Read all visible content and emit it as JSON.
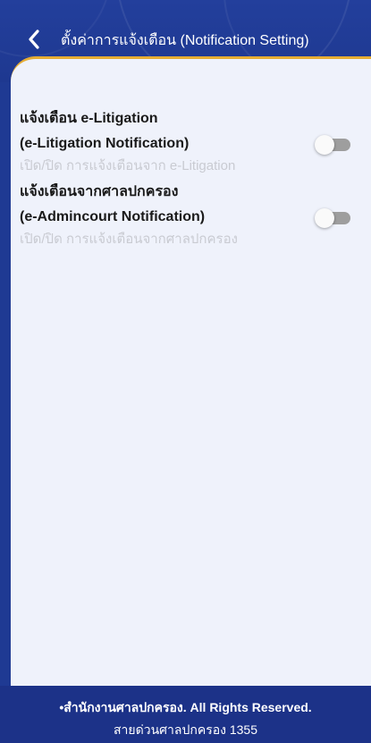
{
  "header": {
    "title": "ตั้งค่าการแจ้งเตือน (Notification Setting)",
    "back_icon": "chevron-left-icon"
  },
  "settings": [
    {
      "title_line1": "แจ้งเตือน e-Litigation",
      "title_line2": "(e-Litigation Notification)",
      "description": "เปิด/ปิด การแจ้งเตือนจาก e-Litigation",
      "enabled": false
    },
    {
      "title_line1": "แจ้งเตือนจากศาลปกครอง",
      "title_line2": "(e-Admincourt Notification)",
      "description": "เปิด/ปิด การแจ้งเตือนจากศาลปกครอง",
      "enabled": false
    }
  ],
  "footer": {
    "copyright": "•สำนักงานศาลปกครอง. All Rights Reserved.",
    "hotline": "สายด่วนศาลปกครอง 1355"
  },
  "colors": {
    "header_bg": "#233f9c",
    "accent": "#e6ad34",
    "panel_bg": "#eff2fb",
    "toggle_off": "#9e9e9e"
  }
}
